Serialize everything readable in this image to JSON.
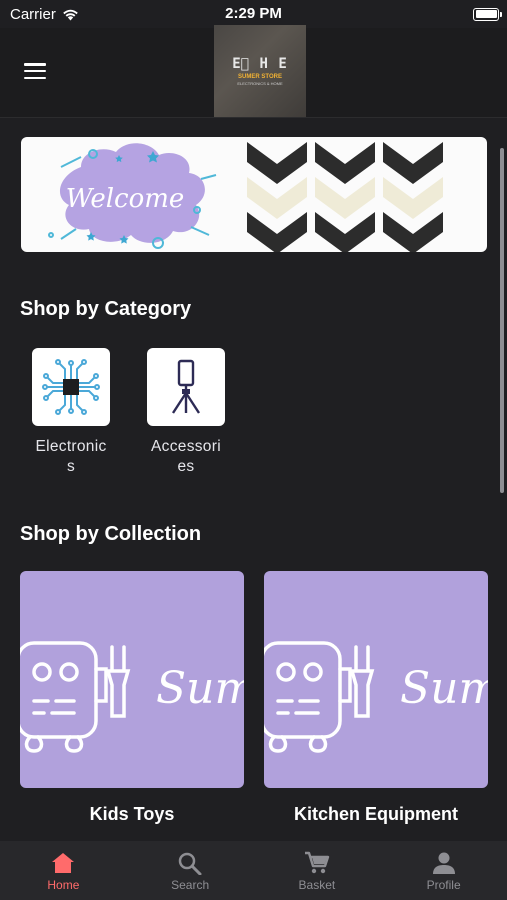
{
  "status_bar": {
    "carrier": "Carrier",
    "time": "2:29 PM"
  },
  "header": {
    "logo_mark": "E⃞ H E",
    "logo_sub": "SUMER STORE",
    "logo_tag": "ELECTRONICS & HOME"
  },
  "banner": {
    "text": "Welcome"
  },
  "sections": {
    "categories_title": "Shop by Category",
    "collections_title": "Shop by Collection"
  },
  "categories": [
    {
      "label": "Electronics",
      "icon": "circuit-chip-icon"
    },
    {
      "label": "Accessories",
      "icon": "phone-tripod-icon"
    }
  ],
  "collections": [
    {
      "label": "Kids Toys",
      "art_text": "Sum"
    },
    {
      "label": "Kitchen Equipment",
      "art_text": "Sum"
    }
  ],
  "tabs": [
    {
      "label": "Home",
      "icon": "home-icon",
      "active": true
    },
    {
      "label": "Search",
      "icon": "search-icon",
      "active": false
    },
    {
      "label": "Basket",
      "icon": "cart-icon",
      "active": false
    },
    {
      "label": "Profile",
      "icon": "person-icon",
      "active": false
    }
  ],
  "colors": {
    "background": "#1f1f22",
    "accent": "#ff6b6b",
    "collection_tile": "#b1a1dc",
    "inactive_tab": "#8e8e93"
  }
}
